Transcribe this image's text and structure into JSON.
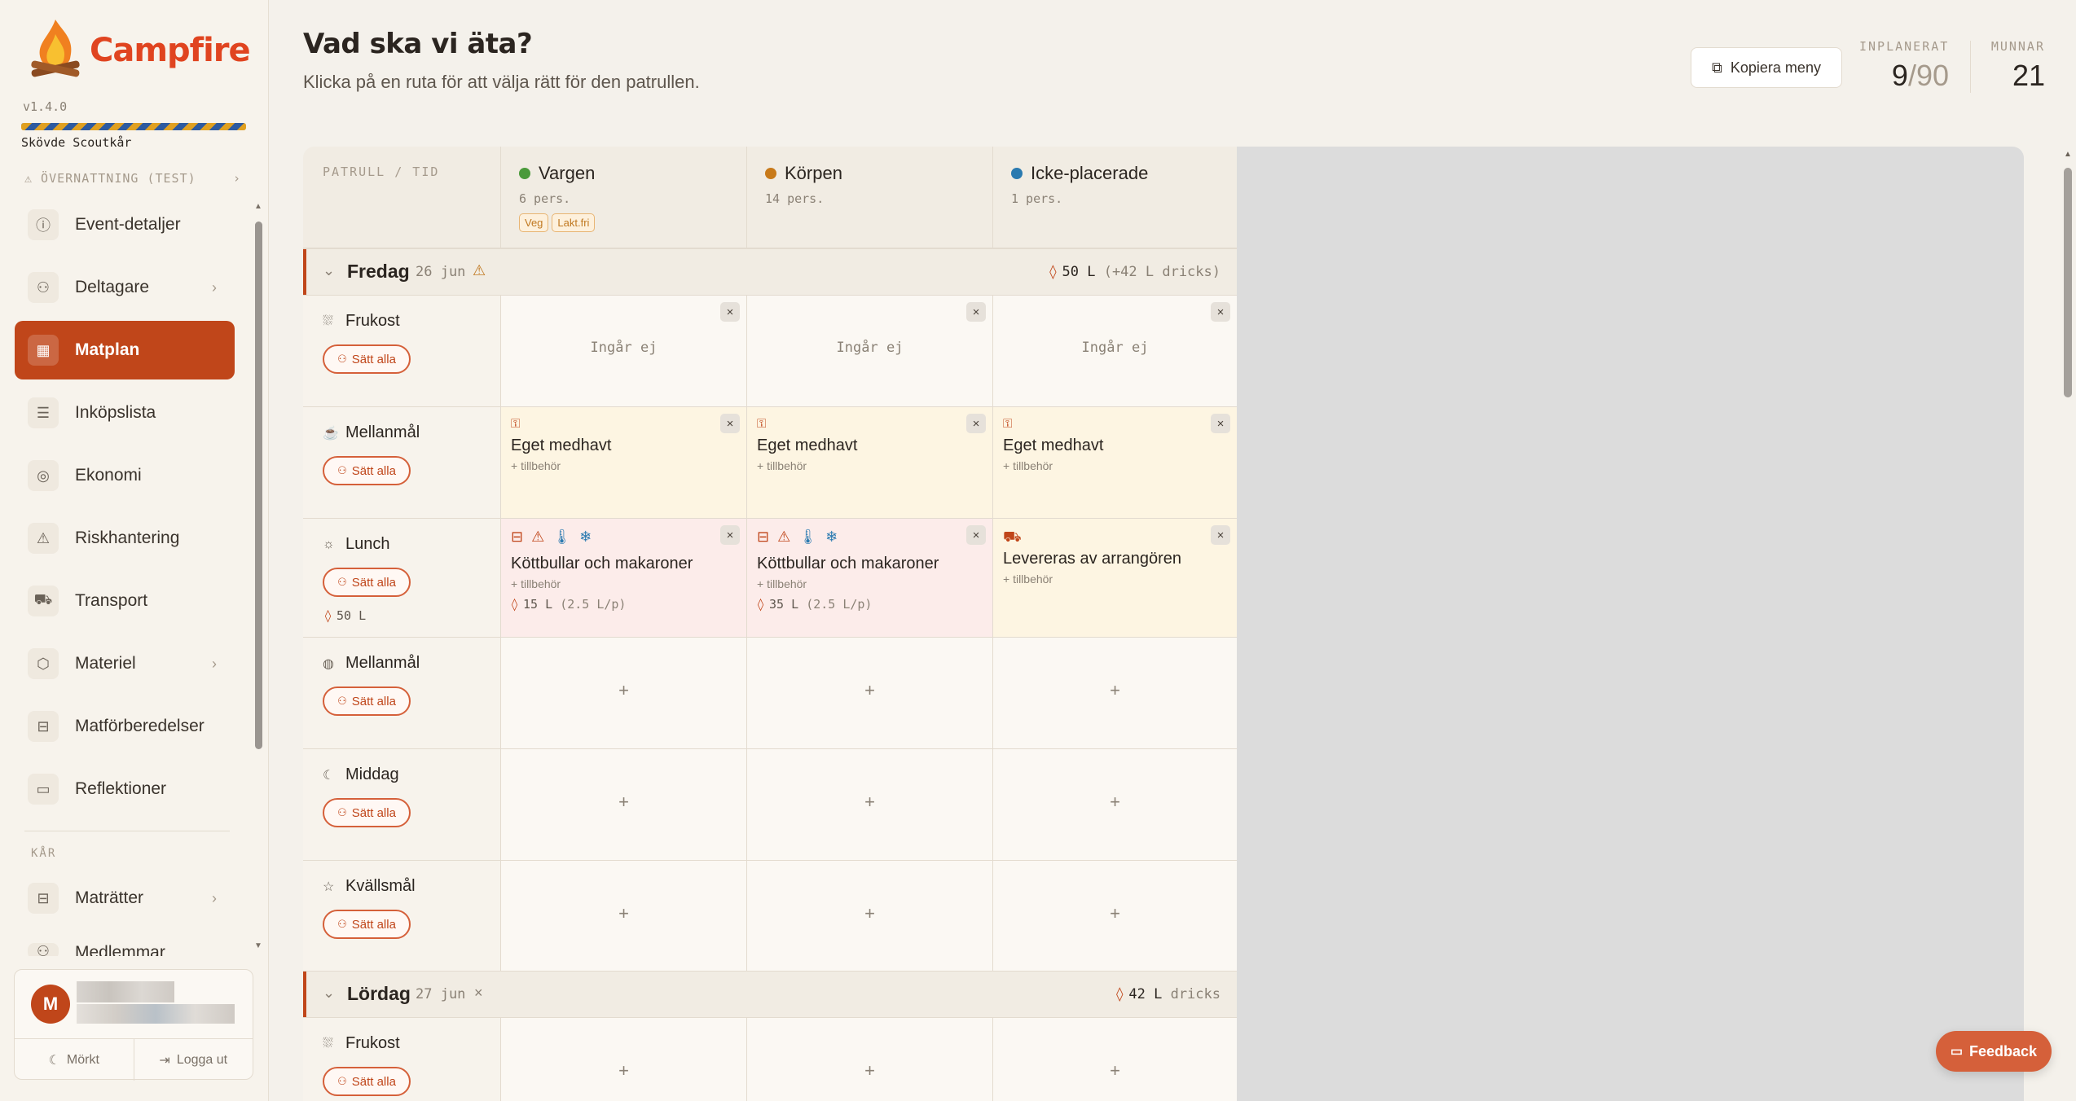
{
  "app": {
    "name": "Campfire",
    "version": "v1.4.0",
    "org": "Skövde Scoutkår",
    "event_label": "⚠ ÖVERNATTNING (TEST)",
    "event_chevron": "›"
  },
  "sidebar": {
    "items": [
      {
        "label": "Event-detaljer",
        "icon": "info-icon",
        "glyph": "ⓘ",
        "chevron": ""
      },
      {
        "label": "Deltagare",
        "icon": "users-icon",
        "glyph": "⚇",
        "chevron": "›"
      },
      {
        "label": "Matplan",
        "icon": "calendar-icon",
        "glyph": "▦",
        "chevron": "",
        "active": true
      },
      {
        "label": "Inköpslista",
        "icon": "list-icon",
        "glyph": "☰",
        "chevron": ""
      },
      {
        "label": "Ekonomi",
        "icon": "coins-icon",
        "glyph": "◎",
        "chevron": ""
      },
      {
        "label": "Riskhantering",
        "icon": "warning-icon",
        "glyph": "⚠",
        "chevron": ""
      },
      {
        "label": "Transport",
        "icon": "truck-icon",
        "glyph": "⛟",
        "chevron": ""
      },
      {
        "label": "Materiel",
        "icon": "box-icon",
        "glyph": "⬡",
        "chevron": "›"
      },
      {
        "label": "Matförberedelser",
        "icon": "pot-icon",
        "glyph": "⊟",
        "chevron": ""
      },
      {
        "label": "Reflektioner",
        "icon": "message-icon",
        "glyph": "▭",
        "chevron": ""
      }
    ],
    "section_kar": "KÅR",
    "kar_items": [
      {
        "label": "Maträtter",
        "icon": "pot-icon",
        "glyph": "⊟",
        "chevron": "›"
      },
      {
        "label": "Medlemmar",
        "icon": "users-icon",
        "glyph": "⚇",
        "chevron": "›"
      }
    ],
    "user": {
      "initial": "M",
      "dark_label": "Mörkt",
      "dark_glyph": "☾",
      "logout_label": "Logga ut",
      "logout_glyph": "⇥"
    }
  },
  "header": {
    "title": "Vad ska vi äta?",
    "subtitle": "Klicka på en ruta för att välja rätt för den patrullen.",
    "copy_label": "Kopiera meny",
    "planned_label": "INPLANERAT",
    "planned_value": "9",
    "planned_total": "/90",
    "mouths_label": "MUNNAR",
    "mouths_value": "21"
  },
  "grid": {
    "corner_label": "PATRULL / TID",
    "columns": [
      {
        "name": "Vargen",
        "persons": "6 pers.",
        "color": "#4a9a3a",
        "tags": [
          "Veg",
          "Lakt.fri"
        ]
      },
      {
        "name": "Körpen",
        "persons": "14 pers.",
        "color": "#c87a1a",
        "tags": []
      },
      {
        "name": "Icke-placerade",
        "persons": "1 pers.",
        "color": "#2a7ab0",
        "tags": []
      }
    ],
    "set_all_label": "Sätt alla",
    "set_all_glyph": "⚇",
    "close_glyph": "×",
    "plus_glyph": "+",
    "chevron_glyph": "⌄",
    "drop_glyph": "💧",
    "days": [
      {
        "name": "Fredag",
        "date": "26 jun",
        "status_glyph": "⚠",
        "water": "50 L",
        "water_extra": "(+42 L dricks)",
        "meals": [
          {
            "name": "Frukost",
            "icon": "breakfast-icon",
            "glyph": "☕"
          },
          {
            "name": "Mellanmål",
            "icon": "cup-icon",
            "glyph": "☕"
          },
          {
            "name": "Lunch",
            "icon": "sun-icon",
            "glyph": "☼",
            "water": "50 L"
          },
          {
            "name": "Mellanmål",
            "icon": "apple-icon",
            "glyph": "◍"
          },
          {
            "name": "Middag",
            "icon": "moon-icon",
            "glyph": "☾"
          },
          {
            "name": "Kvällsmål",
            "icon": "star-icon",
            "glyph": "☆"
          }
        ]
      },
      {
        "name": "Lördag",
        "date": "27 jun",
        "status_glyph": "×",
        "water": "42 L",
        "water_extra": "dricks",
        "meals": [
          {
            "name": "Frukost",
            "icon": "breakfast-icon",
            "glyph": "☕"
          }
        ]
      }
    ],
    "cells": {
      "excluded_label": "Ingår ej",
      "own_title": "Eget medhavt",
      "own_glyph": "🔒",
      "accessories_label": "+ tillbehör",
      "dish_title": "Köttbullar och makaroner",
      "dish_glyphs": [
        "🍲",
        "⚠",
        "🌡",
        "❄"
      ],
      "dish_water_vargen": "15 L",
      "dish_water_korpen": "35 L",
      "dish_water_rate": "(2.5 L/p)",
      "arranged_title": "Levereras av arrangören",
      "arranged_glyph": "🚚"
    }
  },
  "feedback": {
    "label": "Feedback",
    "glyph": "💬"
  },
  "colors": {
    "accent": "#c0461a",
    "brand": "#e04420",
    "own_bg": "#fdf5e2",
    "dish_bg": "#fcecea"
  }
}
